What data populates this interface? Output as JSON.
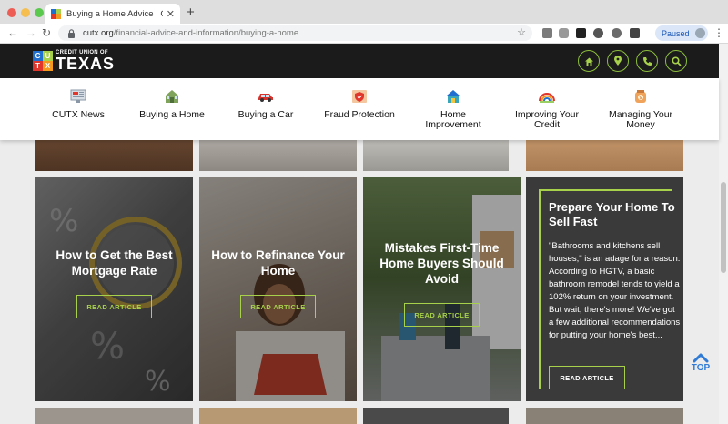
{
  "browser": {
    "tab_title": "Buying a Home Advice | Credi",
    "url_domain": "cutx.org",
    "url_path": "/financial-advice-and-information/buying-a-home",
    "profile_status": "Paused"
  },
  "site": {
    "logo_letters": [
      "C",
      "U",
      "T",
      "X"
    ],
    "logo_small": "CREDIT UNION OF",
    "logo_big": "TEXAS",
    "brand_colors": {
      "green": "#a7d14b",
      "red": "#e0362c",
      "blue": "#1f6fd1",
      "orange": "#f39a1f"
    },
    "header_icons": [
      "home-icon",
      "location-pin-icon",
      "phone-icon",
      "search-icon"
    ]
  },
  "nav": {
    "items": [
      {
        "label": "CUTX News",
        "icon": "news-monitor-icon"
      },
      {
        "label": "Buying a Home",
        "icon": "house-icon"
      },
      {
        "label": "Buying a Car",
        "icon": "car-icon"
      },
      {
        "label": "Fraud Protection",
        "icon": "shield-icon"
      },
      {
        "label": "Home\nImprovement",
        "icon": "home-improvement-icon"
      },
      {
        "label": "Improving Your\nCredit",
        "icon": "rainbow-icon"
      },
      {
        "label": "Managing Your\nMoney",
        "icon": "money-jar-icon"
      }
    ]
  },
  "articles": [
    {
      "title": "How to Get the Best Mortgage Rate",
      "button": "READ ARTICLE"
    },
    {
      "title": "How to Refinance Your Home",
      "button": "READ ARTICLE"
    },
    {
      "title": "Mistakes First-Time Home Buyers Should Avoid",
      "button": "READ ARTICLE"
    }
  ],
  "feature": {
    "title": "Prepare Your Home To Sell Fast",
    "text": "\"Bathrooms and kitchens sell houses,\" is an adage for a reason. According to HGTV, a basic bathroom remodel tends to yield a 102% return on your investment. But wait, there's more! We've got a few additional recommendations for putting your home's best...",
    "button": "READ ARTICLE"
  },
  "top_button": {
    "label": "TOP"
  }
}
